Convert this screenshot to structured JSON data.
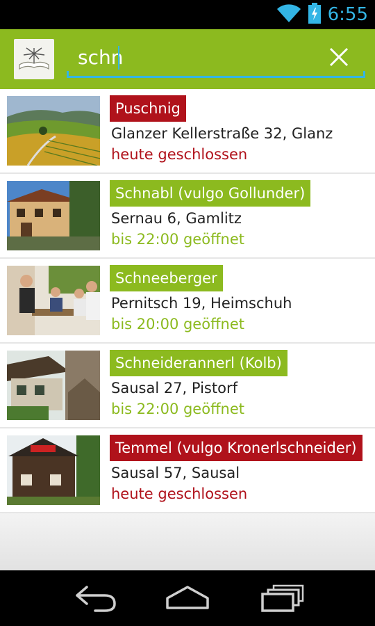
{
  "status_bar": {
    "time": "6:55",
    "icons": [
      "wifi-icon",
      "battery-charging-icon"
    ],
    "accent_color": "#33b5e5"
  },
  "action_bar": {
    "background_color": "#8cba1f",
    "app_icon": "winery-logo-icon",
    "search": {
      "value": "schn",
      "placeholder": ""
    },
    "clear_icon": "close-icon"
  },
  "results": [
    {
      "name": "Puschnig",
      "address": "Glanzer Kellerstraße 32, Glanz",
      "hours": "heute geschlossen",
      "status": "closed",
      "thumbnail": "vineyard-hills-photo"
    },
    {
      "name": "Schnabl (vulgo Gollunder)",
      "address": "Sernau 6, Gamlitz",
      "hours": "bis 22:00 geöffnet",
      "status": "open",
      "thumbnail": "farmhouse-photo"
    },
    {
      "name": "Schneeberger",
      "address": "Pernitsch 19, Heimschuh",
      "hours": "bis 20:00 geöffnet",
      "status": "open",
      "thumbnail": "people-at-table-photo"
    },
    {
      "name": "Schneideranner​l (Kolb)",
      "address": "Sausal 27, Pistorf",
      "hours": "bis 22:00 geöffnet",
      "status": "open",
      "thumbnail": "wooden-house-sign-photo"
    },
    {
      "name": "Temmel (vulgo Kronerlschneider)",
      "address": "Sausal 57, Sausal",
      "hours": "heute geschlossen",
      "status": "closed",
      "thumbnail": "wooden-cottage-photo"
    }
  ],
  "colors": {
    "open": "#8cba1f",
    "closed": "#b0121b"
  },
  "nav_bar": {
    "icons": [
      "back-icon",
      "home-icon",
      "recent-apps-icon"
    ]
  }
}
